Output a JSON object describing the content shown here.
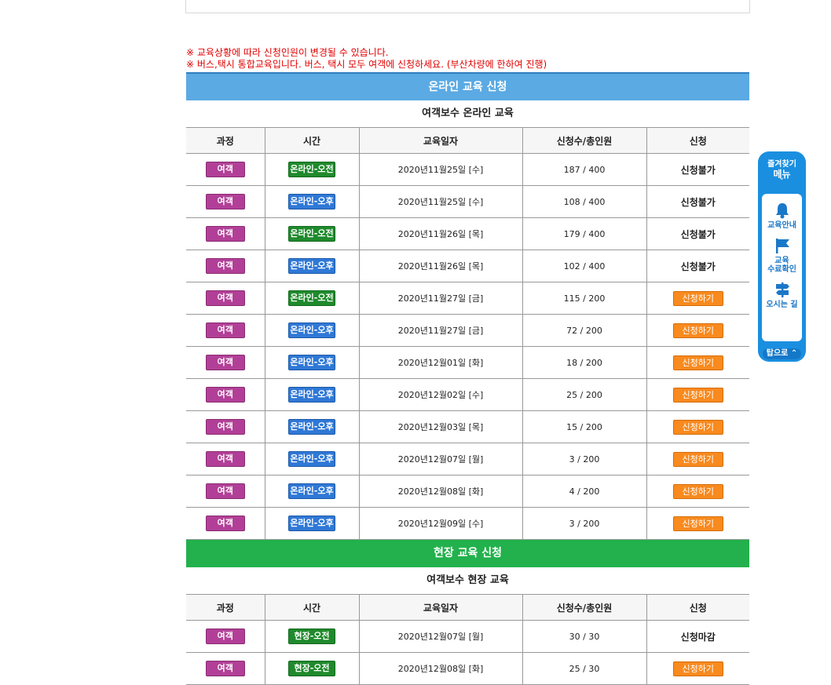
{
  "notices": [
    "※ 교육상황에 따라 신청인원이 변경될 수 있습니다.",
    "※ 버스,택시 통합교육입니다. 버스, 택시 모두 여객에 신청하세요. (부산차량에 한하여 진행)"
  ],
  "online": {
    "header": "온라인 교육 신청",
    "subtitle": "여객보수 온라인 교육",
    "columns": [
      "과정",
      "시간",
      "교육일자",
      "신청수/총인원",
      "신청"
    ],
    "rows": [
      {
        "course": "여객",
        "session": "온라인-오전",
        "ampm": "am",
        "date": "2020년11월25일 [수]",
        "count": "187 / 400",
        "status": "신청불가",
        "can_apply": false
      },
      {
        "course": "여객",
        "session": "온라인-오후",
        "ampm": "pm",
        "date": "2020년11월25일 [수]",
        "count": "108 / 400",
        "status": "신청불가",
        "can_apply": false
      },
      {
        "course": "여객",
        "session": "온라인-오전",
        "ampm": "am",
        "date": "2020년11월26일 [목]",
        "count": "179 / 400",
        "status": "신청불가",
        "can_apply": false
      },
      {
        "course": "여객",
        "session": "온라인-오후",
        "ampm": "pm",
        "date": "2020년11월26일 [목]",
        "count": "102 / 400",
        "status": "신청불가",
        "can_apply": false
      },
      {
        "course": "여객",
        "session": "온라인-오전",
        "ampm": "am",
        "date": "2020년11월27일 [금]",
        "count": "115 / 200",
        "status": "신청하기",
        "can_apply": true
      },
      {
        "course": "여객",
        "session": "온라인-오후",
        "ampm": "pm",
        "date": "2020년11월27일 [금]",
        "count": "72 / 200",
        "status": "신청하기",
        "can_apply": true
      },
      {
        "course": "여객",
        "session": "온라인-오후",
        "ampm": "pm",
        "date": "2020년12월01일 [화]",
        "count": "18 / 200",
        "status": "신청하기",
        "can_apply": true
      },
      {
        "course": "여객",
        "session": "온라인-오후",
        "ampm": "pm",
        "date": "2020년12월02일 [수]",
        "count": "25 / 200",
        "status": "신청하기",
        "can_apply": true
      },
      {
        "course": "여객",
        "session": "온라인-오후",
        "ampm": "pm",
        "date": "2020년12월03일 [목]",
        "count": "15 / 200",
        "status": "신청하기",
        "can_apply": true
      },
      {
        "course": "여객",
        "session": "온라인-오후",
        "ampm": "pm",
        "date": "2020년12월07일 [월]",
        "count": "3 / 200",
        "status": "신청하기",
        "can_apply": true
      },
      {
        "course": "여객",
        "session": "온라인-오후",
        "ampm": "pm",
        "date": "2020년12월08일 [화]",
        "count": "4 / 200",
        "status": "신청하기",
        "can_apply": true
      },
      {
        "course": "여객",
        "session": "온라인-오후",
        "ampm": "pm",
        "date": "2020년12월09일 [수]",
        "count": "3 / 200",
        "status": "신청하기",
        "can_apply": true
      }
    ]
  },
  "onsite": {
    "header": "현장 교육 신청",
    "subtitle": "여객보수 현장 교육",
    "columns": [
      "과정",
      "시간",
      "교육일자",
      "신청수/총인원",
      "신청"
    ],
    "rows": [
      {
        "course": "여객",
        "session": "현장-오전",
        "ampm": "am",
        "date": "2020년12월07일 [월]",
        "count": "30 / 30",
        "status": "신청마감",
        "can_apply": false
      },
      {
        "course": "여객",
        "session": "현장-오전",
        "ampm": "am",
        "date": "2020년12월08일 [화]",
        "count": "25 / 30",
        "status": "신청하기",
        "can_apply": true
      }
    ]
  },
  "quick_menu": {
    "title_line1": "즐겨찾기",
    "title_line2": "메뉴",
    "items": [
      {
        "label1": "교육안내",
        "label2": "",
        "icon": "bell-icon"
      },
      {
        "label1": "교육",
        "label2": "수료확인",
        "icon": "flag-icon"
      },
      {
        "label1": "오시는 길",
        "label2": "",
        "icon": "signpost-icon"
      }
    ],
    "top_label": "탑으로 ⌃"
  },
  "colors": {
    "online_header": "#5baae3",
    "onsite_header": "#22b14c",
    "course_badge": "#b23f97",
    "am_badge": "#1f8a2c",
    "pm_badge": "#2f78d6",
    "apply_button": "#f88a1e",
    "notice_text": "#e00000",
    "quick_menu": "#1a8fe0"
  }
}
